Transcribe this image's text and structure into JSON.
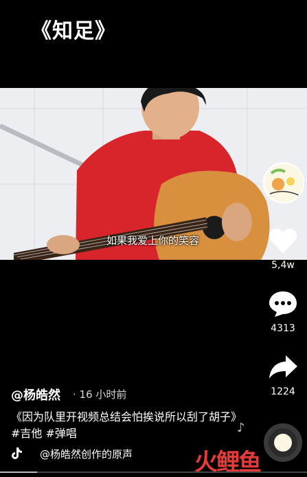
{
  "header": {
    "title": "《知足》"
  },
  "video": {
    "subtitle": "如果我爱上你的笑容",
    "progress": 0.12
  },
  "actions": {
    "like_count": "5,4w",
    "comment_count": "4313",
    "share_count": "1224"
  },
  "post": {
    "author": "@杨皓然",
    "time": "· 16 小时前",
    "description": "《因为队里开视频总结会怕挨说所以刮了胡子》#吉他 #弹唱"
  },
  "music": {
    "label": "@杨皓然创作的原声",
    "extra": "@"
  },
  "watermark": {
    "text": "火鲤鱼",
    "color": "#e53b3b"
  },
  "colors": {
    "background": "#000000",
    "shirt": "#d8242b",
    "guitar": "#d9903e"
  }
}
